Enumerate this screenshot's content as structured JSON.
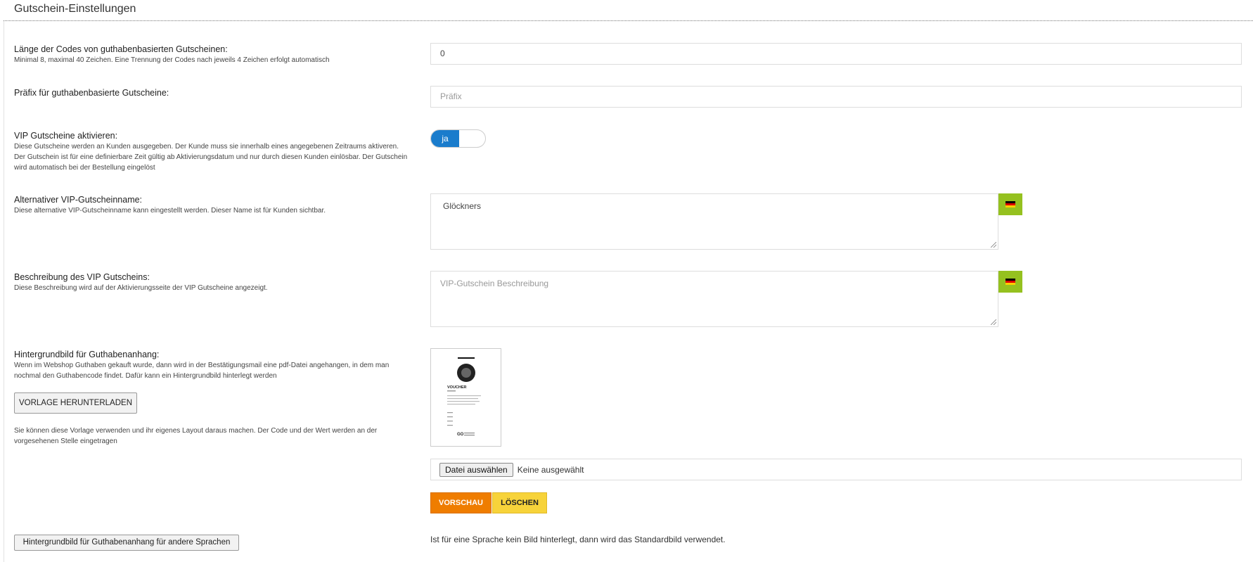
{
  "section": {
    "title": "Gutschein-Einstellungen"
  },
  "code_length": {
    "label": "Länge der Codes von guthabenbasierten Gutscheinen:",
    "desc": "Minimal 8, maximal 40 Zeichen. Eine Trennung der Codes nach jeweils 4 Zeichen erfolgt automatisch",
    "value": "0"
  },
  "prefix": {
    "label": "Präfix für guthabenbasierte Gutscheine:",
    "placeholder": "Präfix"
  },
  "vip_activate": {
    "label": "VIP Gutscheine aktivieren:",
    "desc": "Diese Gutscheine werden an Kunden ausgegeben. Der Kunde muss sie innerhalb eines angegebenen Zeitraums aktiveren. Der Gutschein ist für eine definierbare Zeit gültig ab Aktivierungsdatum und nur durch diesen Kunden einlösbar. Der Gutschein wird automatisch bei der Bestellung eingelöst",
    "toggle_label": "ja"
  },
  "vip_name": {
    "label": "Alternativer VIP-Gutscheinname:",
    "desc": "Diese alternative VIP-Gutscheinname kann eingestellt werden. Dieser Name ist für Kunden sichtbar.",
    "value": "Glöckners"
  },
  "vip_desc": {
    "label": "Beschreibung des VIP Gutscheins:",
    "desc": "Diese Beschreibung wird auf der Aktivierungsseite der VIP Gutscheine angezeigt.",
    "placeholder": "VIP-Gutschein Beschreibung"
  },
  "flag_icon": "german-flag-icon",
  "flag_colors": [
    "#000000",
    "#dd0000",
    "#ffce00"
  ],
  "background_image": {
    "label": "Hintergrundbild für Guthabenanhang:",
    "desc": "Wenn im Webshop Guthaben gekauft wurde, dann wird in der Bestätigungsmail eine pdf-Datei angehangen, in dem man nochmal den Guthabencode findet. Dafür kann ein Hintergrundbild hinterlegt werden",
    "download_button": "VORLAGE HERUNTERLADEN",
    "desc2": "Sie können diese Vorlage verwenden und ihr eigenes Layout daraus machen. Der Code und der Wert werden an der vorgesehenen Stelle eingetragen",
    "file_button": "Datei auswählen",
    "file_status": "Keine ausgewählt",
    "preview_button": "VORSCHAU",
    "delete_button": "LÖSCHEN"
  },
  "voucher_preview": {
    "heading": "VOUCHER",
    "logo_text": "GO"
  },
  "other_languages": {
    "button": "Hintergrundbild für Guthabenanhang für andere Sprachen",
    "note": "Ist für eine Sprache kein Bild hinterlegt, dann wird das Standardbild verwendet."
  },
  "colors": {
    "toggle_on": "#1a7ccc",
    "flag_button": "#95c11f",
    "preview_button": "#ef7d00",
    "delete_button": "#f7d33a"
  }
}
